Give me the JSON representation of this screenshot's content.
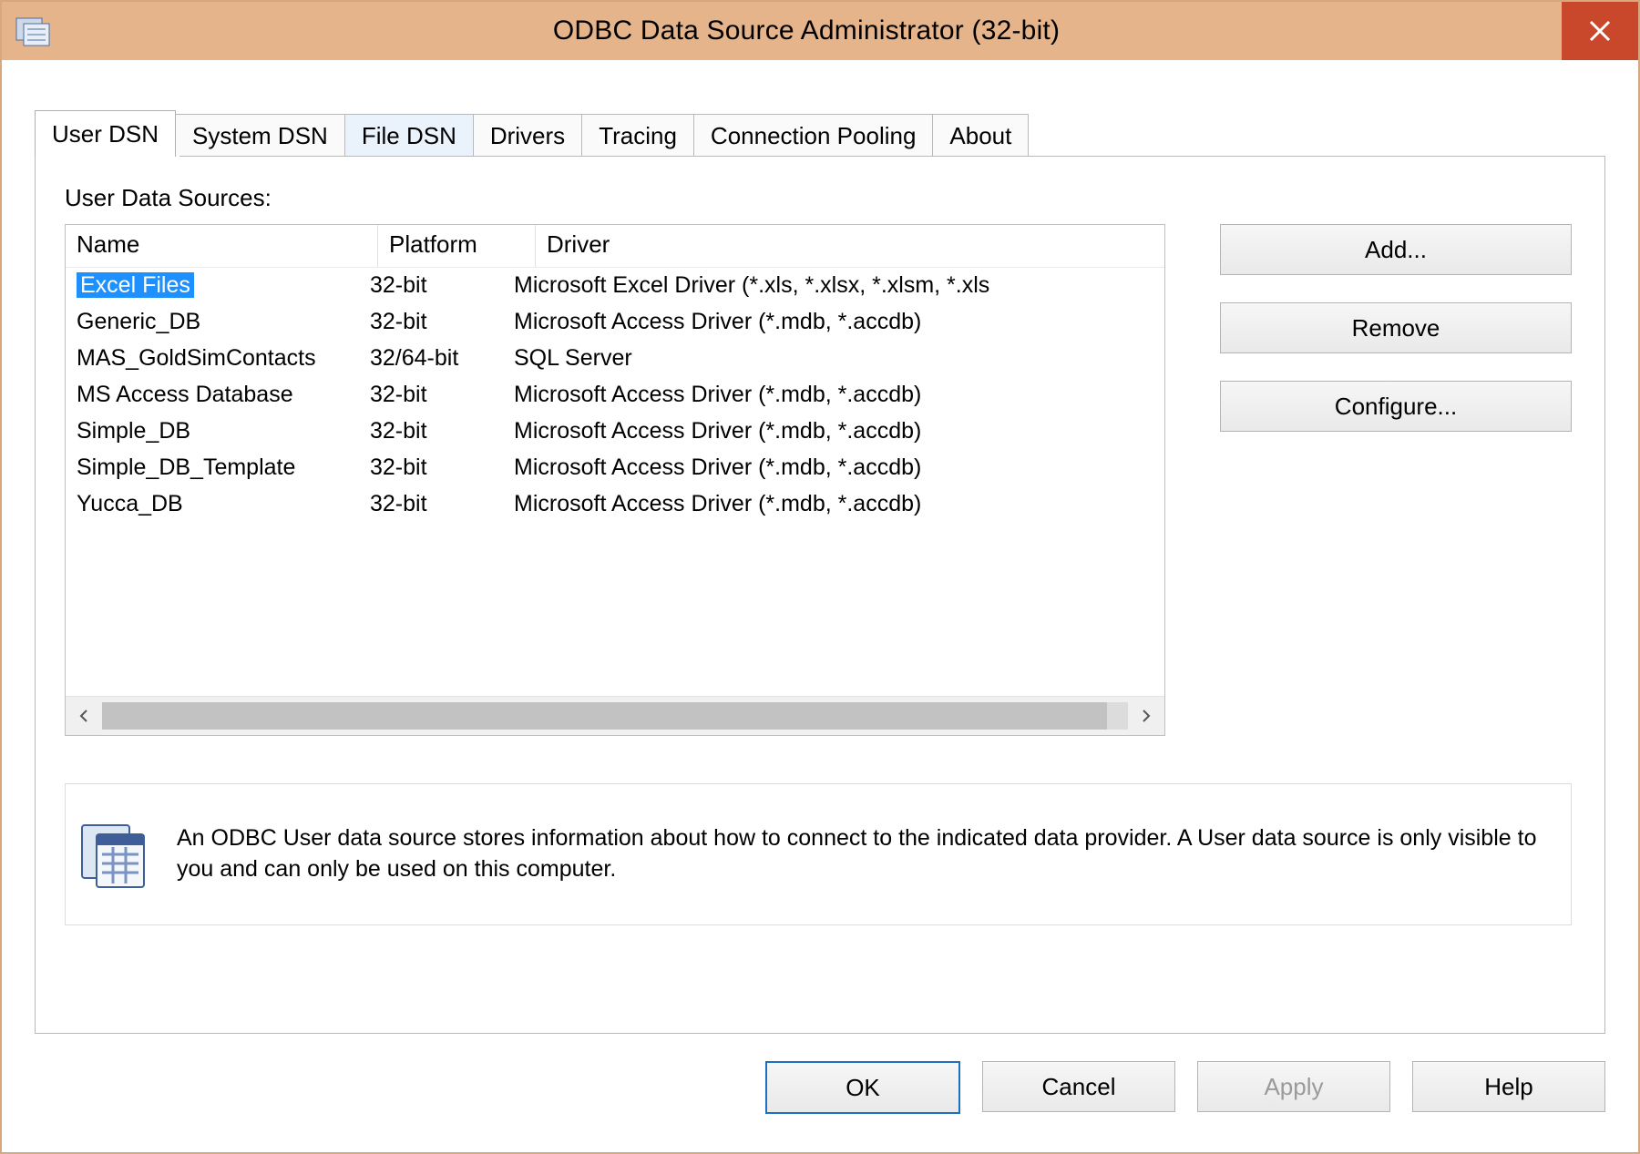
{
  "window": {
    "title": "ODBC Data Source Administrator (32-bit)"
  },
  "tabs": [
    {
      "label": "User DSN"
    },
    {
      "label": "System DSN"
    },
    {
      "label": "File DSN"
    },
    {
      "label": "Drivers"
    },
    {
      "label": "Tracing"
    },
    {
      "label": "Connection Pooling"
    },
    {
      "label": "About"
    }
  ],
  "section_label": "User Data Sources:",
  "columns": {
    "name": "Name",
    "platform": "Platform",
    "driver": "Driver"
  },
  "rows": [
    {
      "name": "Excel Files",
      "platform": "32-bit",
      "driver": "Microsoft Excel Driver (*.xls, *.xlsx, *.xlsm, *.xls",
      "selected": true
    },
    {
      "name": "Generic_DB",
      "platform": "32-bit",
      "driver": "Microsoft Access Driver (*.mdb, *.accdb)"
    },
    {
      "name": "MAS_GoldSimContacts",
      "platform": "32/64-bit",
      "driver": "SQL Server"
    },
    {
      "name": "MS Access Database",
      "platform": "32-bit",
      "driver": "Microsoft Access Driver (*.mdb, *.accdb)"
    },
    {
      "name": "Simple_DB",
      "platform": "32-bit",
      "driver": "Microsoft Access Driver (*.mdb, *.accdb)"
    },
    {
      "name": "Simple_DB_Template",
      "platform": "32-bit",
      "driver": "Microsoft Access Driver (*.mdb, *.accdb)"
    },
    {
      "name": "Yucca_DB",
      "platform": "32-bit",
      "driver": "Microsoft Access Driver (*.mdb, *.accdb)"
    }
  ],
  "actions": {
    "add": "Add...",
    "remove": "Remove",
    "configure": "Configure..."
  },
  "info_text": "An ODBC User data source stores information about how to connect to the indicated data provider.   A User data source is only visible to you and can only be used on this computer.",
  "dialog_buttons": {
    "ok": "OK",
    "cancel": "Cancel",
    "apply": "Apply",
    "help": "Help"
  }
}
